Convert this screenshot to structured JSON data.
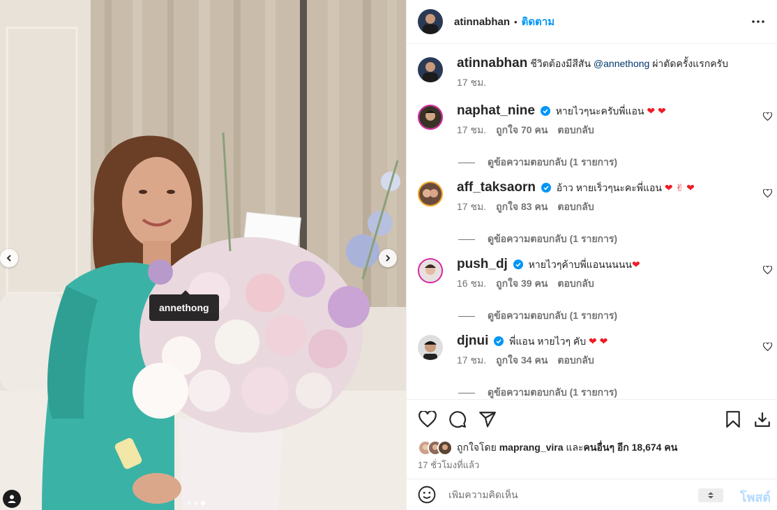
{
  "post": {
    "photo": {
      "tag_label": "annethong",
      "slide_count": 3,
      "active_slide": 3
    }
  },
  "header": {
    "username": "atinnabhan",
    "separator": "•",
    "follow_label": "ติดตาม",
    "more_icon": "more-horizontal-icon"
  },
  "caption": {
    "username": "atinnabhan",
    "text_before": "ชีวิตต้องมีสีสัน ",
    "mention": "@annethong",
    "text_after": " ผ่าตัดครั้งแรกครับ",
    "time": "17 ชม."
  },
  "comments": [
    {
      "username": "naphat_nine",
      "verified": true,
      "text": "หายไวๆนะครับพี่แอน",
      "emoji": "❤ ❤",
      "time": "17 ชม.",
      "likes": "ถูกใจ 70 คน",
      "reply_label": "ตอบกลับ",
      "view_replies": "ดูข้อความตอบกลับ (1 รายการ)"
    },
    {
      "username": "aff_taksaorn",
      "verified": true,
      "text": "อ้าว หายเร็วๆนะคะพี่แอน",
      "emoji": "❤ ✌ ❤",
      "time": "17 ชม.",
      "likes": "ถูกใจ 83 คน",
      "reply_label": "ตอบกลับ",
      "view_replies": "ดูข้อความตอบกลับ (1 รายการ)"
    },
    {
      "username": "push_dj",
      "verified": true,
      "text": "หายไวๆค้าบพี่แอนนนนน",
      "emoji": "❤",
      "time": "16 ชม.",
      "likes": "ถูกใจ 39 คน",
      "reply_label": "ตอบกลับ",
      "view_replies": "ดูข้อความตอบกลับ (1 รายการ)"
    },
    {
      "username": "djnui",
      "verified": true,
      "text": "พี่แอน หายไวๆ คับ",
      "emoji": "❤ ❤",
      "time": "17 ชม.",
      "likes": "ถูกใจ 34 คน",
      "reply_label": "ตอบกลับ",
      "view_replies": "ดูข้อความตอบกลับ (1 รายการ)"
    }
  ],
  "actions": {
    "like_icon": "heart-icon",
    "comment_icon": "comment-icon",
    "share_icon": "send-icon",
    "save_icon": "bookmark-icon",
    "download_icon": "download-icon"
  },
  "likes": {
    "prefix": "ถูกใจโดย ",
    "user": "maprang_vira",
    "middle": " และ",
    "others": "คนอื่นๆ อีก 18,674 คน"
  },
  "posted_time": "17 ชั่วโมงที่แล้ว",
  "composer": {
    "placeholder": "เพิ่มความคิดเห็น",
    "post_label": "โพสต์"
  },
  "colors": {
    "accent": "#0095f6",
    "verified": "#0095f6",
    "heart": "#ed1c24",
    "post_disabled": "#b3dbff"
  }
}
